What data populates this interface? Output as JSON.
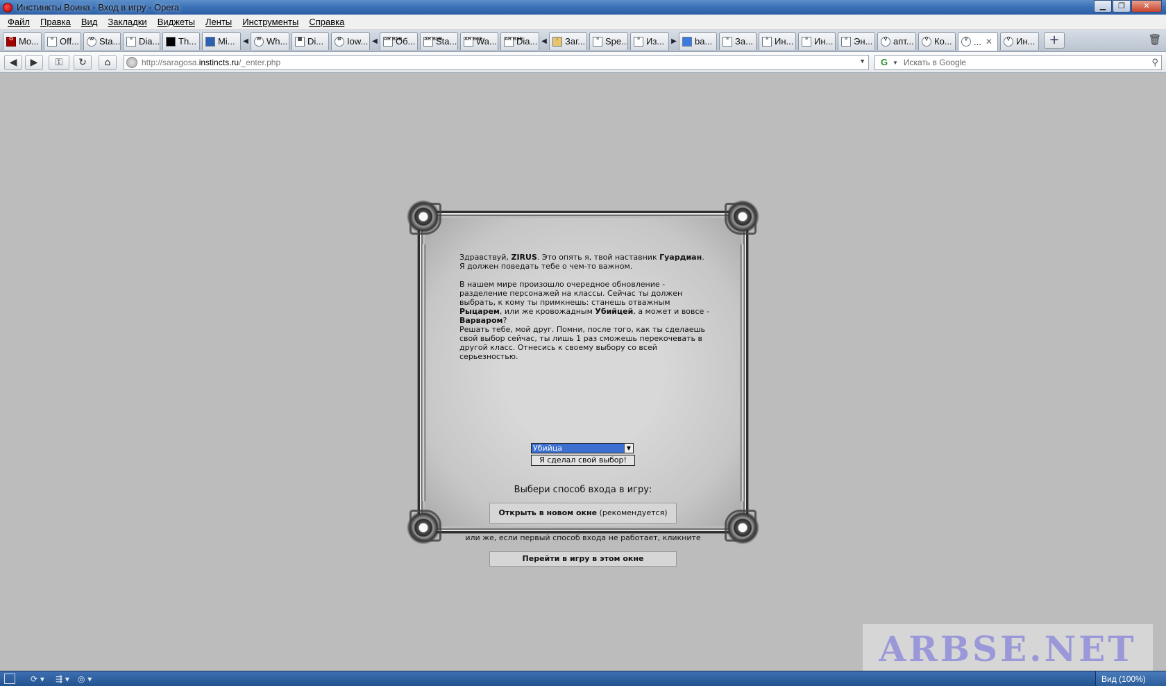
{
  "window": {
    "title": "Инстинкты Воина - Вход в игру - Opera"
  },
  "menu": [
    "Файл",
    "Правка",
    "Вид",
    "Закладки",
    "Виджеты",
    "Ленты",
    "Инструменты",
    "Справка"
  ],
  "tabs": [
    {
      "label": "Mo...",
      "icon": "opera-icon"
    },
    {
      "label": "Off...",
      "icon": "page-icon"
    },
    {
      "label": "Sta...",
      "icon": "wordpress-icon"
    },
    {
      "label": "Dia...",
      "icon": "page-icon"
    },
    {
      "label": "Th...",
      "icon": "black-square-icon"
    },
    {
      "label": "Mi...",
      "icon": "blue-square-icon"
    },
    {
      "label": "Wh...",
      "icon": "wordpress-icon"
    },
    {
      "label": "Di...",
      "icon": "table-icon"
    },
    {
      "label": "Iow...",
      "icon": "gear-icon"
    },
    {
      "label": "Об...",
      "icon": "arbse-icon"
    },
    {
      "label": "Sta...",
      "icon": "arbse-icon"
    },
    {
      "label": "Wa...",
      "icon": "arbse-icon"
    },
    {
      "label": "Dia...",
      "icon": "arbse-icon"
    },
    {
      "label": "Заг...",
      "icon": "download-icon"
    },
    {
      "label": "Spe...",
      "icon": "page-icon"
    },
    {
      "label": "Из...",
      "icon": "page-icon"
    },
    {
      "label": "ba...",
      "icon": "blue-app-icon"
    },
    {
      "label": "За...",
      "icon": "page-icon"
    },
    {
      "label": "Ин...",
      "icon": "page-icon"
    },
    {
      "label": "Ин...",
      "icon": "page-icon"
    },
    {
      "label": "Эн...",
      "icon": "page-icon"
    },
    {
      "label": "апт...",
      "icon": "search-icon"
    },
    {
      "label": "Ко...",
      "icon": "search-icon"
    },
    {
      "label": "...",
      "icon": "search-icon",
      "active": true
    },
    {
      "label": "Ин...",
      "icon": "search-icon"
    }
  ],
  "address": {
    "scheme": "http://saragosa.",
    "host": "instincts.ru",
    "path": "/_enter.php"
  },
  "search": {
    "placeholder": "Искать в Google",
    "engine_glyph": "G"
  },
  "content": {
    "greeting_pre": "Здравствуй, ",
    "username": "ZIRUS",
    "greeting_mid": ". Это опять я, твой наставник ",
    "mentor": "Гуардиан",
    "greeting_post": ". Я должен поведать тебе о чем-то важном.",
    "update_pre": "В нашем мире произошло очередное обновление - разделение персонажей на классы. Сейчас ты должен выбрать, к кому ты примкнешь: станешь отважным ",
    "class_knight": "Рыцарем",
    "update_mid1": ", или же кровожадным ",
    "class_assassin": "Убийцей",
    "update_mid2": ", а может и вовсе - ",
    "class_barbarian": "Варваром",
    "update_post": "?",
    "warning": "Решать тебе, мой друг. Помни, после того, как ты сделаешь свой выбор сейчас, ты лишь 1 раз сможешь перекочевать в другой класс. Отнесись к своему выбору со всей серьезностью.",
    "select_value": "Убийца",
    "choice_button": "Я сделал свой выбор!",
    "choose_way": "Выбери способ входа в игру:",
    "open_new_window_bold": "Открыть в новом окне",
    "open_new_window_note": " (рекомендуется)",
    "or_text": "или же, если первый способ входа не работает, кликните",
    "enter_here": "Перейти в игру в этом окне"
  },
  "watermark": "ARBSE.NET",
  "statusbar": {
    "zoom": "Вид (100%)"
  }
}
